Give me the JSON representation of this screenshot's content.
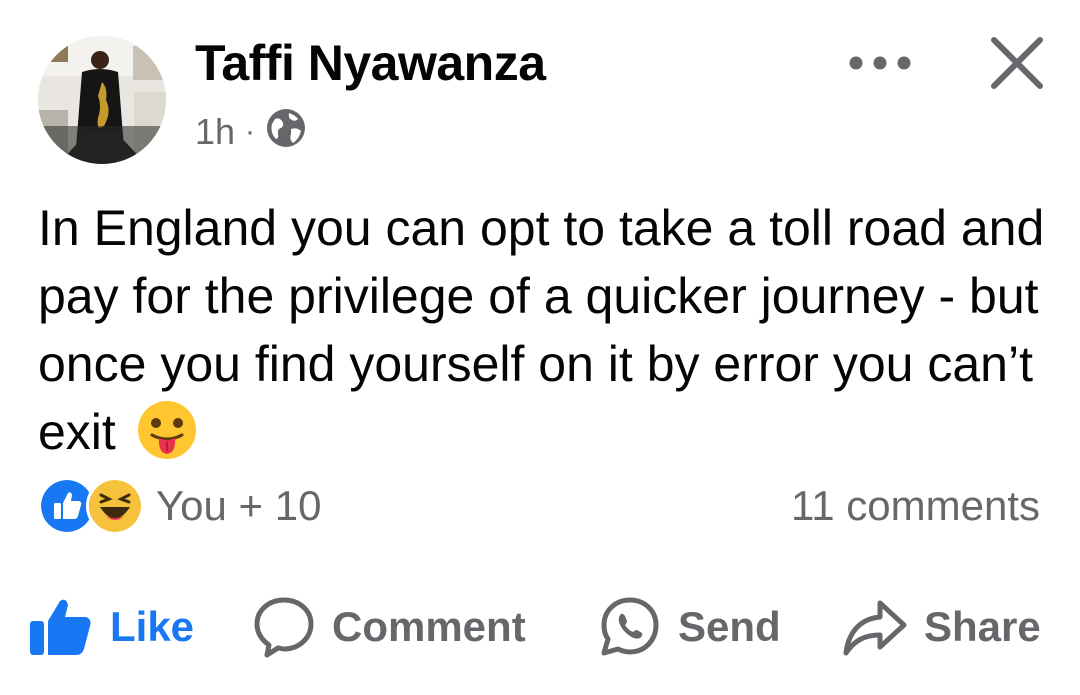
{
  "post": {
    "author": "Taffi Nyawanza",
    "timestamp": "1h",
    "separator": "·",
    "audience_icon": "globe-icon",
    "text": "In England you can opt to take a toll road and pay for the privilege of a quicker journey - but once you find yourself on it by error you can’t exit",
    "text_emoji": "😛",
    "reactions": {
      "icons": [
        "like-reaction-icon",
        "haha-reaction-icon"
      ],
      "summary": "You + 10"
    },
    "comments_count": "11 comments"
  },
  "header": {
    "more_icon": "more-options-icon",
    "close_icon": "close-icon"
  },
  "actions": {
    "like": "Like",
    "comment": "Comment",
    "send": "Send",
    "share": "Share"
  },
  "colors": {
    "accent": "#1877f2",
    "secondary_text": "#65676b",
    "primary_text": "#050505"
  }
}
